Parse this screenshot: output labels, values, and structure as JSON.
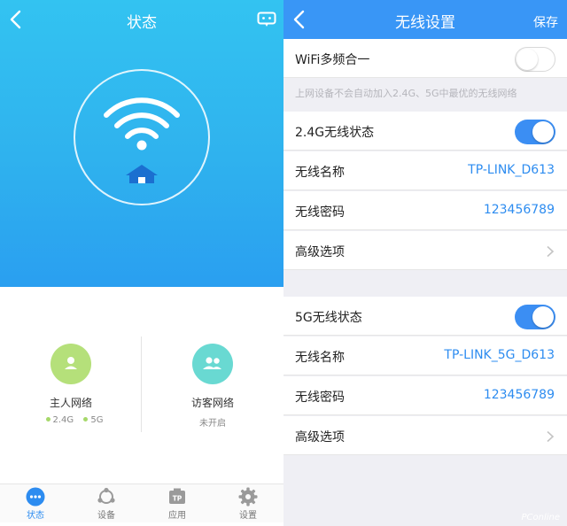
{
  "left": {
    "title": "状态",
    "networks": [
      {
        "name": "主人网络",
        "bands": [
          "2.4G",
          "5G"
        ]
      },
      {
        "name": "访客网络",
        "status": "未开启"
      }
    ],
    "tabs": [
      {
        "label": "状态",
        "icon": "more-dots-icon",
        "active": true
      },
      {
        "label": "设备",
        "icon": "devices-icon",
        "active": false
      },
      {
        "label": "应用",
        "icon": "apps-tp-icon",
        "active": false
      },
      {
        "label": "设置",
        "icon": "gear-icon",
        "active": false
      }
    ]
  },
  "right": {
    "title": "无线设置",
    "save_label": "保存",
    "multi_band": {
      "label": "WiFi多频合一",
      "enabled": false
    },
    "hint": "上网设备不会自动加入2.4G、5G中最优的无线网络",
    "band24": {
      "status_label": "2.4G无线状态",
      "enabled": true,
      "ssid_label": "无线名称",
      "ssid": "TP-LINK_D613",
      "password_label": "无线密码",
      "password": "123456789",
      "advanced_label": "高级选项"
    },
    "band5": {
      "status_label": "5G无线状态",
      "enabled": true,
      "ssid_label": "无线名称",
      "ssid": "TP-LINK_5G_D613",
      "password_label": "无线密码",
      "password": "123456789",
      "advanced_label": "高级选项"
    }
  },
  "watermark": "PConline",
  "colors": {
    "accent": "#2d8cf0",
    "header_blue": "#3996f6",
    "hero_cyan": "#33c3f1",
    "green": "#b5e07a",
    "teal": "#69d9d2"
  }
}
